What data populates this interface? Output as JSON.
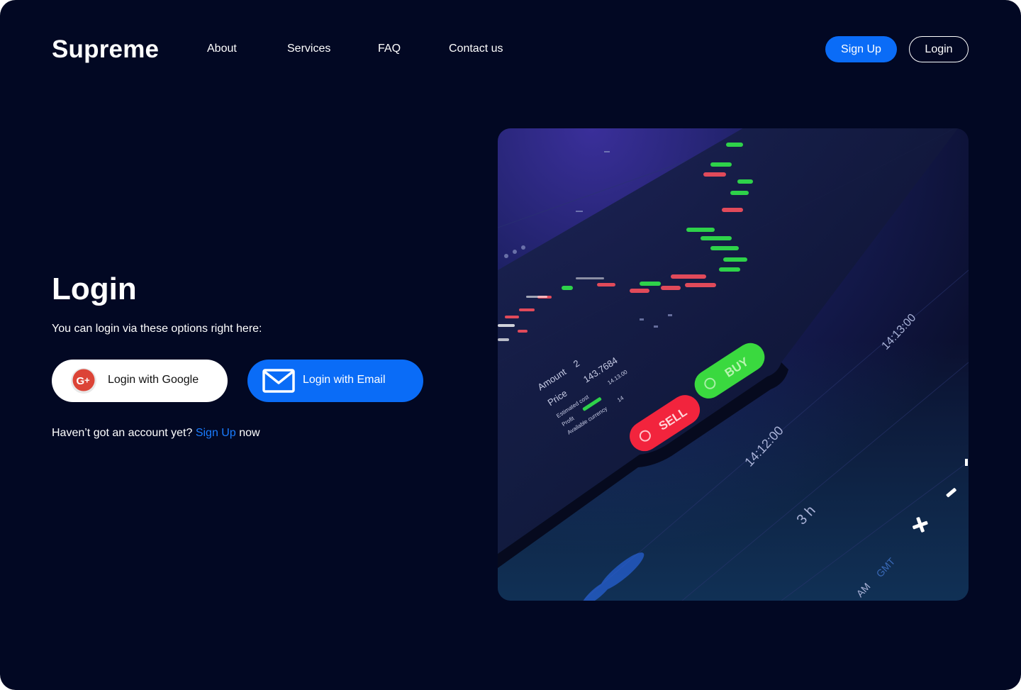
{
  "brand": {
    "logo": "Supreme"
  },
  "nav": {
    "items": [
      {
        "label": "About"
      },
      {
        "label": "Services"
      },
      {
        "label": "FAQ"
      },
      {
        "label": "Contact us"
      }
    ],
    "signup_label": "Sign Up",
    "login_label": "Login"
  },
  "login": {
    "title": "Login",
    "subtitle": "You can login via these options right here:",
    "google_label": "Login with Google",
    "email_label": "Login with Email",
    "no_account_text": "Haven’t got an account yet?",
    "signup_link": "Sign Up",
    "suffix": "now"
  },
  "hero": {
    "order_panel": {
      "amount_label": "Amount",
      "amount_value": "2",
      "price_label": "Price",
      "price_value": "143.7684",
      "estimated_cost_label": "Estimated cost",
      "estimated_cost_value": "14.13.00",
      "profit_label": "Profit",
      "available_label": "Available currency",
      "available_value": "14",
      "buy_label": "BUY",
      "sell_label": "SELL"
    },
    "time_labels": [
      "14:13:00",
      "14:12:00"
    ],
    "timeframe": "3 h",
    "period_label": "AM",
    "timezone": "GMT"
  },
  "colors": {
    "background": "#020823",
    "accent": "#0a6cf7",
    "link": "#1a7cff",
    "buy": "#35d63f",
    "sell": "#f2243d"
  },
  "icons": {
    "google": "google-plus-icon",
    "email": "mail-icon",
    "zoom_in": "plus-icon",
    "zoom_out": "minus-icon"
  }
}
